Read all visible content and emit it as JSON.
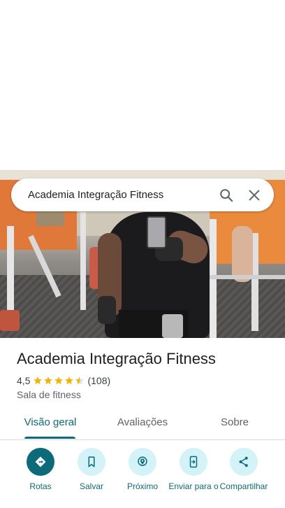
{
  "search": {
    "query": "Academia Integração Fitness"
  },
  "place": {
    "name": "Academia Integração Fitness",
    "rating": "4,5",
    "stars": 4.5,
    "review_count": "(108)",
    "category": "Sala de fitness"
  },
  "tabs": [
    {
      "label": "Visão geral",
      "active": true
    },
    {
      "label": "Avaliações",
      "active": false
    },
    {
      "label": "Sobre",
      "active": false
    }
  ],
  "actions": [
    {
      "label": "Rotas",
      "icon": "directions-icon"
    },
    {
      "label": "Salvar",
      "icon": "bookmark-icon"
    },
    {
      "label": "Próximo",
      "icon": "nearby-icon"
    },
    {
      "label": "Enviar para o",
      "icon": "send-to-phone-icon"
    },
    {
      "label": "Compartilhar",
      "icon": "share-icon"
    }
  ],
  "colors": {
    "accent": "#0b6b78",
    "accent_light": "#d3f3f9",
    "star": "#f4b400"
  }
}
